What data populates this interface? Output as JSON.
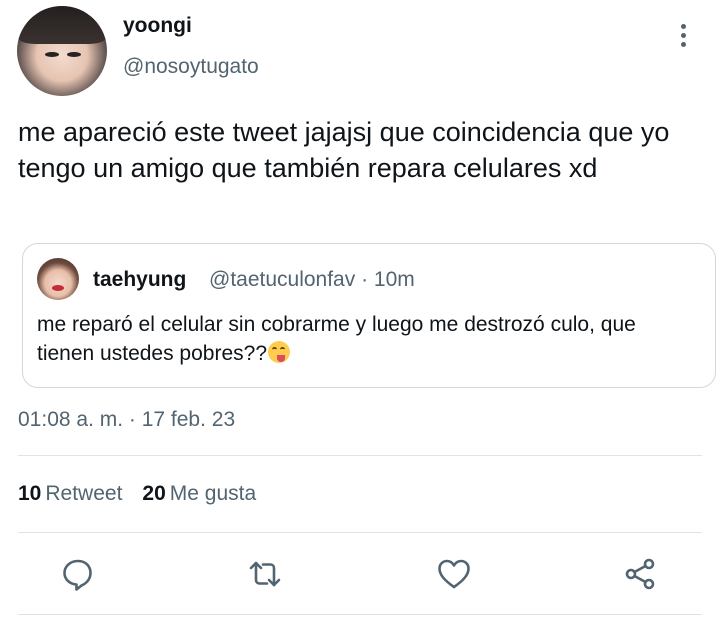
{
  "tweet": {
    "author_name": "yoongi",
    "author_handle": "@nosoytugato",
    "text": "me apareció este tweet jajajsj que coincidencia que yo tengo un amigo que también repara celulares xd",
    "timestamp": "01:08 a. m. · 17 feb. 23"
  },
  "quoted": {
    "author_name": "taehyung",
    "meta": "@taetuculonfav · 10m",
    "text": "me reparó el celular sin cobrarme y luego me destrozó culo, que tienen ustedes pobres??",
    "emoji": "face-savoring-food"
  },
  "stats": {
    "retweets_count": "10",
    "retweets_label": "Retweet",
    "likes_count": "20",
    "likes_label": "Me gusta"
  },
  "actions": [
    "reply-icon",
    "retweet-icon",
    "like-icon",
    "share-icon"
  ],
  "colors": {
    "text": "#0f1419",
    "secondary": "#536471",
    "border": "#cfd9de"
  }
}
